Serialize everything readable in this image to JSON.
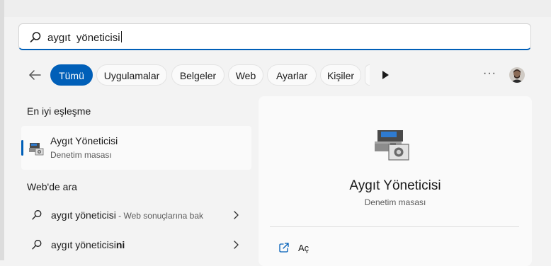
{
  "search": {
    "query": "aygıt  yöneticisi"
  },
  "filters": {
    "chips": [
      {
        "label": "Tümü",
        "active": true
      },
      {
        "label": "Uygulamalar",
        "active": false
      },
      {
        "label": "Belgeler",
        "active": false
      },
      {
        "label": "Web",
        "active": false
      },
      {
        "label": "Ayarlar",
        "active": false
      },
      {
        "label": "Kişiler",
        "active": false
      }
    ],
    "more_label": "···"
  },
  "best_match": {
    "heading": "En iyi eşleşme",
    "title": "Aygıt Yöneticisi",
    "subtitle": "Denetim masası"
  },
  "web": {
    "heading": "Web'de ara",
    "results": [
      {
        "text": "aygıt yöneticisi",
        "hint": " - Web sonuçlarına bak"
      },
      {
        "text_main": "aygıt yöneticisi",
        "text_bold": "ni"
      }
    ]
  },
  "detail": {
    "title": "Aygıt Yöneticisi",
    "subtitle": "Denetim masası",
    "actions": [
      {
        "label": "Aç"
      }
    ]
  },
  "colors": {
    "accent": "#005fb8",
    "background": "#f3f3f3",
    "card": "#fafafa"
  },
  "icons": [
    "search-icon",
    "back-arrow-icon",
    "play-icon",
    "more-icon",
    "avatar",
    "device-manager-icon",
    "chevron-right-icon",
    "open-external-icon"
  ]
}
